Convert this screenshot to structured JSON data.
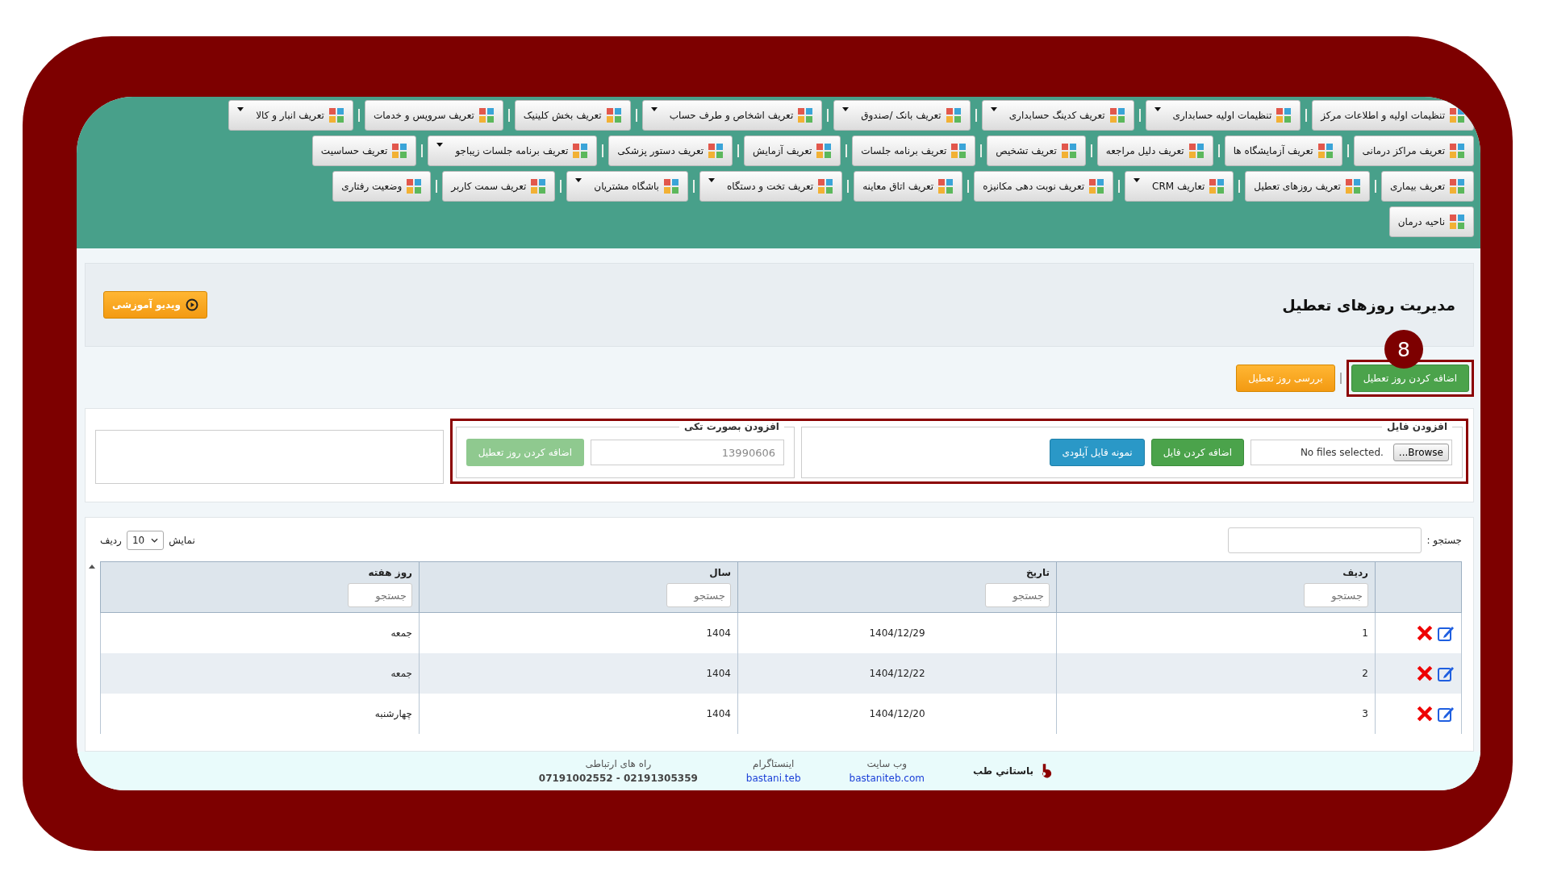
{
  "menu_rows": [
    [
      {
        "label": "تنظیمات اولیه و اطلاعات مرکز",
        "dropdown": false
      },
      {
        "label": "تنظیمات اولیه حسابداری",
        "dropdown": true
      },
      {
        "label": "تعریف کدینگ حسابداری",
        "dropdown": true
      },
      {
        "label": "تعریف بانک /صندوق",
        "dropdown": true
      },
      {
        "label": "تعریف اشخاص و طرف حساب",
        "dropdown": true
      },
      {
        "label": "تعریف بخش کلینیک",
        "dropdown": false
      },
      {
        "label": "تعریف سرویس و خدمات",
        "dropdown": false
      },
      {
        "label": "تعریف انبار و کالا",
        "dropdown": true
      }
    ],
    [
      {
        "label": "تعریف مراکز درمانی",
        "dropdown": false
      },
      {
        "label": "تعریف آزمایشگاه ها",
        "dropdown": false
      },
      {
        "label": "تعریف دلیل مراجعه",
        "dropdown": false
      },
      {
        "label": "تعریف تشخیص",
        "dropdown": false
      },
      {
        "label": "تعریف برنامه جلسات",
        "dropdown": false
      },
      {
        "label": "تعریف آزمایش",
        "dropdown": false
      },
      {
        "label": "تعریف دستور پزشکی",
        "dropdown": false
      },
      {
        "label": "تعریف برنامه جلسات زیباجو",
        "dropdown": true
      },
      {
        "label": "تعریف حساسیت",
        "dropdown": false
      }
    ],
    [
      {
        "label": "تعریف بیماری",
        "dropdown": false
      },
      {
        "label": "تعریف روزهای تعطیل",
        "dropdown": false
      },
      {
        "label": "تعاریف CRM",
        "dropdown": true
      },
      {
        "label": "تعریف نوبت دهی مکانیزه",
        "dropdown": false
      },
      {
        "label": "تعریف اتاق معاینه",
        "dropdown": false
      },
      {
        "label": "تعریف تخت و دستگاه",
        "dropdown": true
      },
      {
        "label": "باشگاه مشتریان",
        "dropdown": true
      },
      {
        "label": "تعریف سمت کاربر",
        "dropdown": false
      },
      {
        "label": "وضعیت رفتاری",
        "dropdown": false
      }
    ],
    [
      {
        "label": "ناحیه درمان",
        "dropdown": false
      }
    ]
  ],
  "header": {
    "title": "مدیریت روزهای تعطیل",
    "video_button": "ویدیو آموزشی"
  },
  "step_badge": "8",
  "actions": [
    {
      "label": "اضافه کردن روز تعطیل",
      "kind": "green",
      "highlighted": true
    },
    {
      "label": "بررسی روز تعطیل",
      "kind": "orange",
      "highlighted": false
    }
  ],
  "upload": {
    "legend": "افزودن فایل",
    "browse": "Browse...",
    "file_status": "No files selected.",
    "add_button": "اضافه کردن فایل",
    "sample_button": "نمونه فایل آپلودی"
  },
  "single": {
    "legend": "افزودن بصورت تکی",
    "placeholder": "13990606",
    "button": "اضافه کردن روز تعطیل"
  },
  "table": {
    "search_label": "جستجو :",
    "show_label": "نمایش",
    "page_size": "10",
    "rows_label": "ردیف",
    "columns": [
      {
        "label": "ردیف",
        "placeholder": "جستجو"
      },
      {
        "label": "تاریخ",
        "placeholder": "جستجو"
      },
      {
        "label": "سال",
        "placeholder": "جستجو"
      },
      {
        "label": "روز هفته",
        "placeholder": "جستجو"
      }
    ],
    "rows": [
      [
        "1",
        "1404/12/29",
        "1404",
        "جمعه"
      ],
      [
        "2",
        "1404/12/22",
        "1404",
        "جمعه"
      ],
      [
        "3",
        "1404/12/20",
        "1404",
        "چهارشنبه"
      ]
    ]
  },
  "footer": {
    "brand": "باستاني طب",
    "website_label": "وب سایت",
    "website": "bastaniteb.com",
    "instagram_label": "اینستاگرام",
    "instagram": "bastani.teb",
    "contact_label": "راه های ارتباطی",
    "phones": "07191002552 - 02191305359"
  }
}
